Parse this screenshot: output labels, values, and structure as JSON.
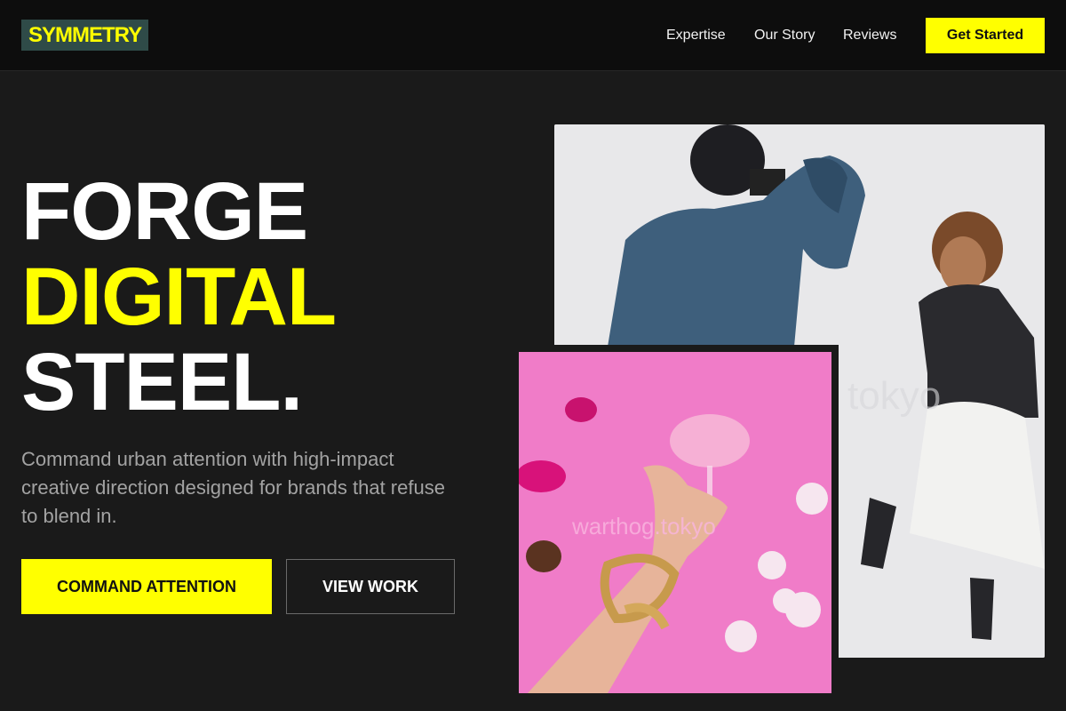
{
  "header": {
    "logo": "SYMMETRY",
    "nav": [
      "Expertise",
      "Our Story",
      "Reviews"
    ],
    "cta": "Get Started"
  },
  "hero": {
    "headline": [
      "FORGE",
      "DIGITAL",
      "STEEL."
    ],
    "subtext": "Command urban attention with high-impact creative direction designed for brands that refuse to blend in.",
    "primary_button": "COMMAND ATTENTION",
    "secondary_button": "VIEW WORK"
  },
  "images": {
    "main": "photographer-shooting-model-photo",
    "inset": "hand-with-gold-chains-pink-drink-photo"
  },
  "colors": {
    "accent": "#ffff00",
    "background": "#1a1a1a",
    "header_bg": "#0d0d0d",
    "logo_bg": "#2f4b48",
    "muted_text": "#a3a3a3"
  }
}
